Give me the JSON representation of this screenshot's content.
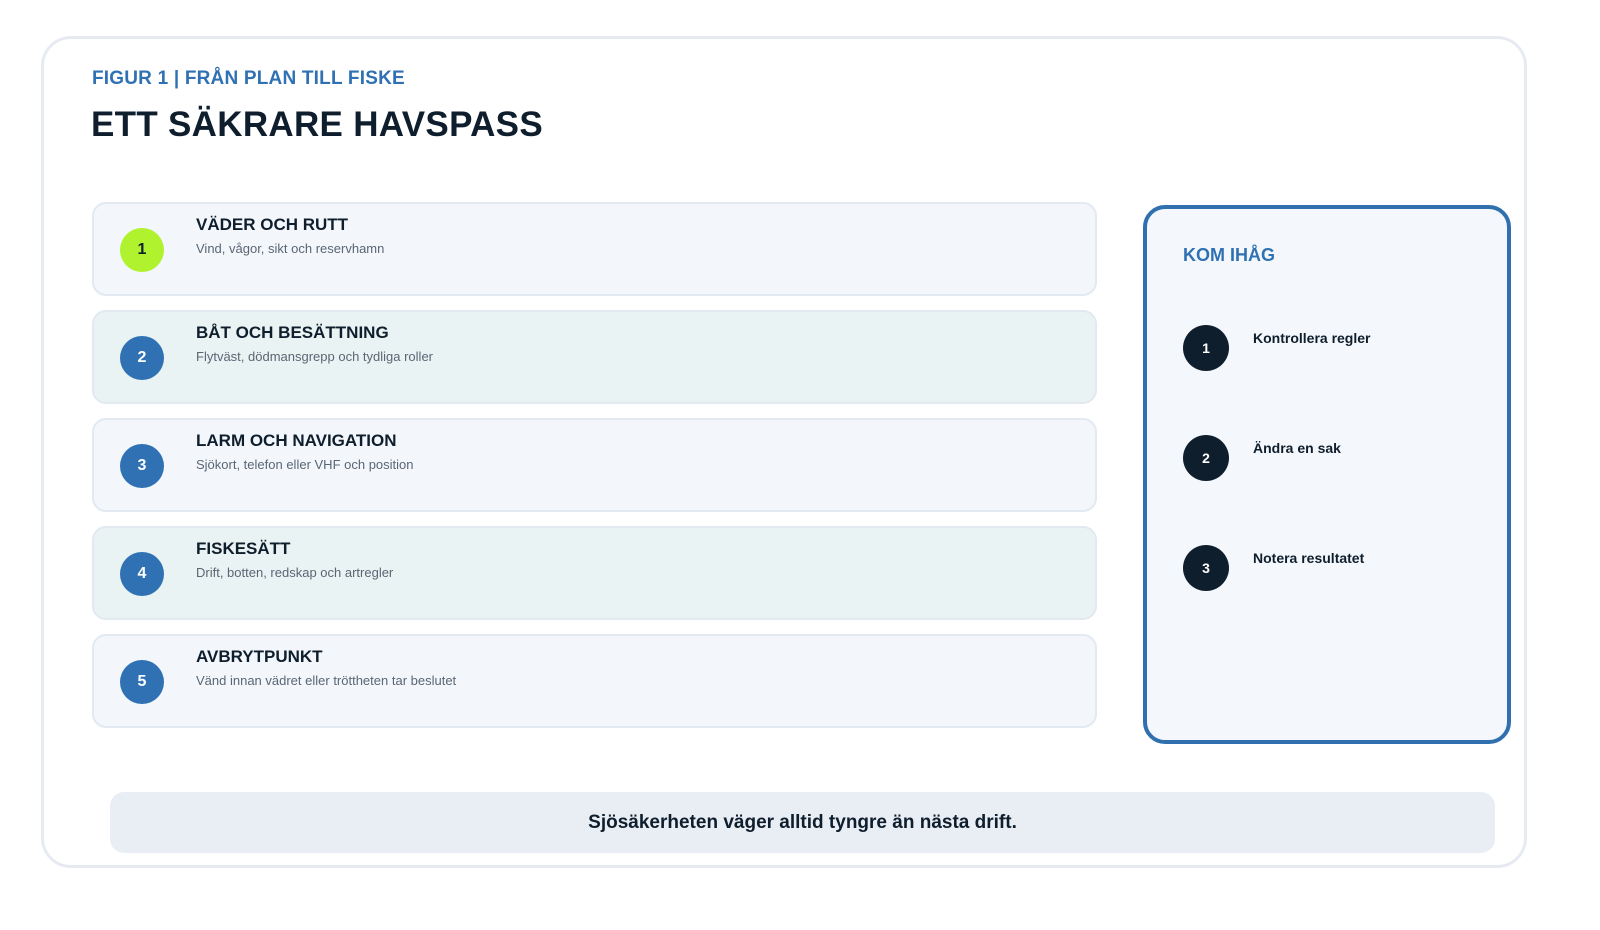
{
  "header": {
    "eyebrow": "FIGUR 1 | FRÅN PLAN TILL FISKE",
    "title": "ETT SÄKRARE HAVSPASS"
  },
  "steps": [
    {
      "number": "1",
      "title": "VÄDER OCH RUTT",
      "description": "Vind, vågor, sikt och reservhamn"
    },
    {
      "number": "2",
      "title": "BÅT OCH BESÄTTNING",
      "description": "Flytväst, dödmansgrepp och tydliga roller"
    },
    {
      "number": "3",
      "title": "LARM OCH NAVIGATION",
      "description": "Sjökort, telefon eller VHF och position"
    },
    {
      "number": "4",
      "title": "FISKESÄTT",
      "description": "Drift, botten, redskap och artregler"
    },
    {
      "number": "5",
      "title": "AVBRYTPUNKT",
      "description": "Vänd innan vädret eller tröttheten tar beslutet"
    }
  ],
  "sidebar": {
    "title": "KOM IHÅG",
    "items": [
      {
        "number": "1",
        "label": "Kontrollera regler"
      },
      {
        "number": "2",
        "label": "Ändra en sak"
      },
      {
        "number": "3",
        "label": "Notera resultatet"
      }
    ]
  },
  "footer": {
    "text": "Sjösäkerheten väger alltid tyngre än nästa drift."
  },
  "colors": {
    "accent": "#2f71b2",
    "highlight": "#b1f22e",
    "dark": "#0f1e2d"
  }
}
